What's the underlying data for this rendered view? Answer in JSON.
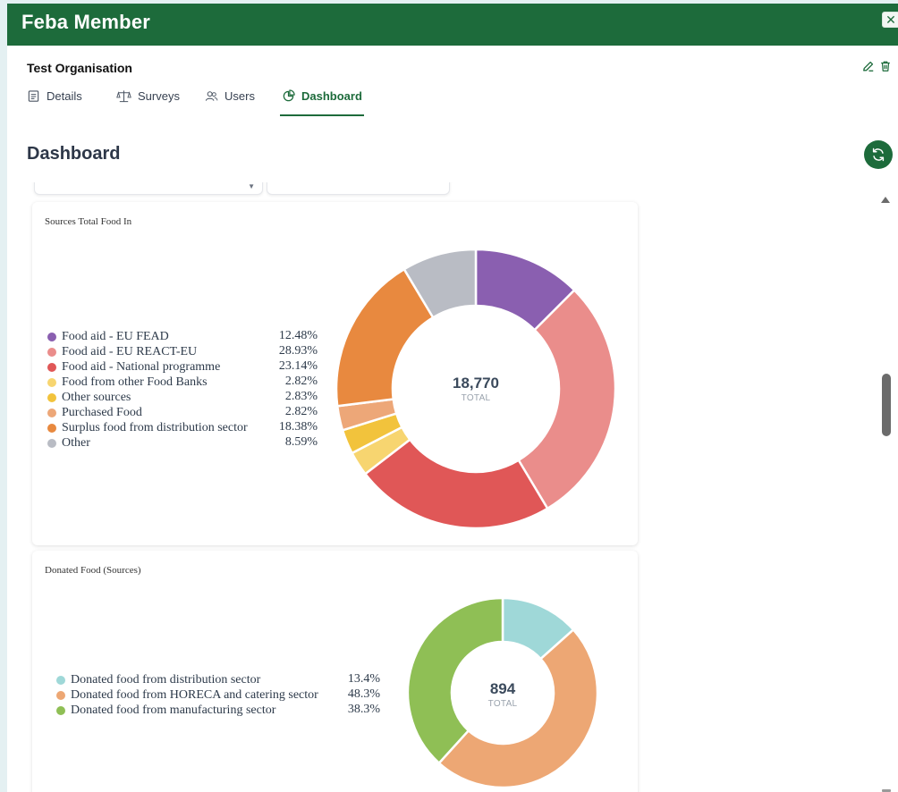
{
  "modal": {
    "title": "Feba Member",
    "close_label": "✕"
  },
  "org": {
    "name": "Test Organisation",
    "edit_icon": "edit-icon",
    "delete_icon": "trash-icon"
  },
  "tabs": [
    {
      "label": "Details",
      "icon": "document-icon",
      "active": false
    },
    {
      "label": "Surveys",
      "icon": "scale-icon",
      "active": false
    },
    {
      "label": "Users",
      "icon": "users-icon",
      "active": false
    },
    {
      "label": "Dashboard",
      "icon": "pie-chart-icon",
      "active": true
    }
  ],
  "page": {
    "title": "Dashboard",
    "refresh_icon": "refresh-icon"
  },
  "chart_data": [
    {
      "type": "pie",
      "title": "Sources Total Food In",
      "center_value": "18,770",
      "center_label": "TOTAL",
      "legend_placement": "left",
      "slices": [
        {
          "label": "Food aid - EU FEAD",
          "value": 12.48,
          "display": "12.48%",
          "color": "#8a5fb0"
        },
        {
          "label": "Food aid - EU REACT-EU",
          "value": 28.93,
          "display": "28.93%",
          "color": "#ea8d8b"
        },
        {
          "label": "Food aid - National programme",
          "value": 23.14,
          "display": "23.14%",
          "color": "#e05757"
        },
        {
          "label": "Food from other Food Banks",
          "value": 2.82,
          "display": "2.82%",
          "color": "#f7d570"
        },
        {
          "label": "Other sources",
          "value": 2.83,
          "display": "2.83%",
          "color": "#f2c33c"
        },
        {
          "label": "Purchased Food",
          "value": 2.82,
          "display": "2.82%",
          "color": "#eda778"
        },
        {
          "label": "Surplus food from distribution sector",
          "value": 18.38,
          "display": "18.38%",
          "color": "#e8893f"
        },
        {
          "label": "Other",
          "value": 8.59,
          "display": "8.59%",
          "color": "#b9bcc4"
        }
      ]
    },
    {
      "type": "pie",
      "title": "Donated Food (Sources)",
      "center_value": "894",
      "center_label": "TOTAL",
      "legend_placement": "left",
      "slices": [
        {
          "label": "Donated food from distribution sector",
          "value": 13.4,
          "display": "13.4%",
          "color": "#9fd8d8"
        },
        {
          "label": "Donated food from HORECA and catering sector",
          "value": 48.3,
          "display": "48.3%",
          "color": "#eda774"
        },
        {
          "label": "Donated food from manufacturing sector",
          "value": 38.3,
          "display": "38.3%",
          "color": "#8fbf55"
        }
      ]
    }
  ]
}
